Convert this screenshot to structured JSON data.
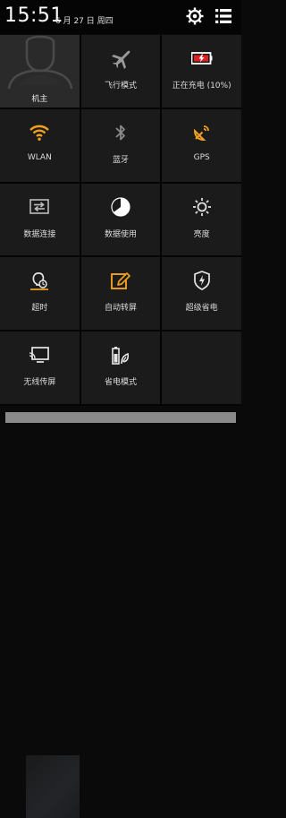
{
  "status": {
    "time": "15:51",
    "date": "6 月 27 日 周四"
  },
  "header": {
    "settings_icon": "gear-icon",
    "menu_icon": "list-icon"
  },
  "user": {
    "name": "机主",
    "icon": "avatar-icon"
  },
  "tiles": [
    {
      "label": "飞行模式",
      "icon": "airplane-icon",
      "active": false
    },
    {
      "label": "正在充电 (10%)",
      "icon": "battery-charging-icon",
      "active": true
    },
    {
      "label": "WLAN",
      "icon": "wifi-icon",
      "active": true
    },
    {
      "label": "蓝牙",
      "icon": "bluetooth-icon",
      "active": false
    },
    {
      "label": "GPS",
      "icon": "gps-icon",
      "active": true
    },
    {
      "label": "数据连接",
      "icon": "data-connection-icon",
      "active": false
    },
    {
      "label": "数据使用",
      "icon": "data-usage-icon",
      "active": false
    },
    {
      "label": "亮度",
      "icon": "brightness-icon",
      "active": false
    },
    {
      "label": "超时",
      "icon": "timeout-icon",
      "active": false
    },
    {
      "label": "自动转屏",
      "icon": "auto-rotate-icon",
      "active": true
    },
    {
      "label": "超级省电",
      "icon": "super-power-saving-icon",
      "active": false
    },
    {
      "label": "无线传屏",
      "icon": "wireless-display-icon",
      "active": false
    },
    {
      "label": "省电模式",
      "icon": "power-saving-icon",
      "active": false
    }
  ],
  "colors": {
    "accent": "#f0a020",
    "inactive_icon": "#bdbdbd",
    "tile_bg": "#1b1b1b",
    "battery_red": "#e02020"
  }
}
